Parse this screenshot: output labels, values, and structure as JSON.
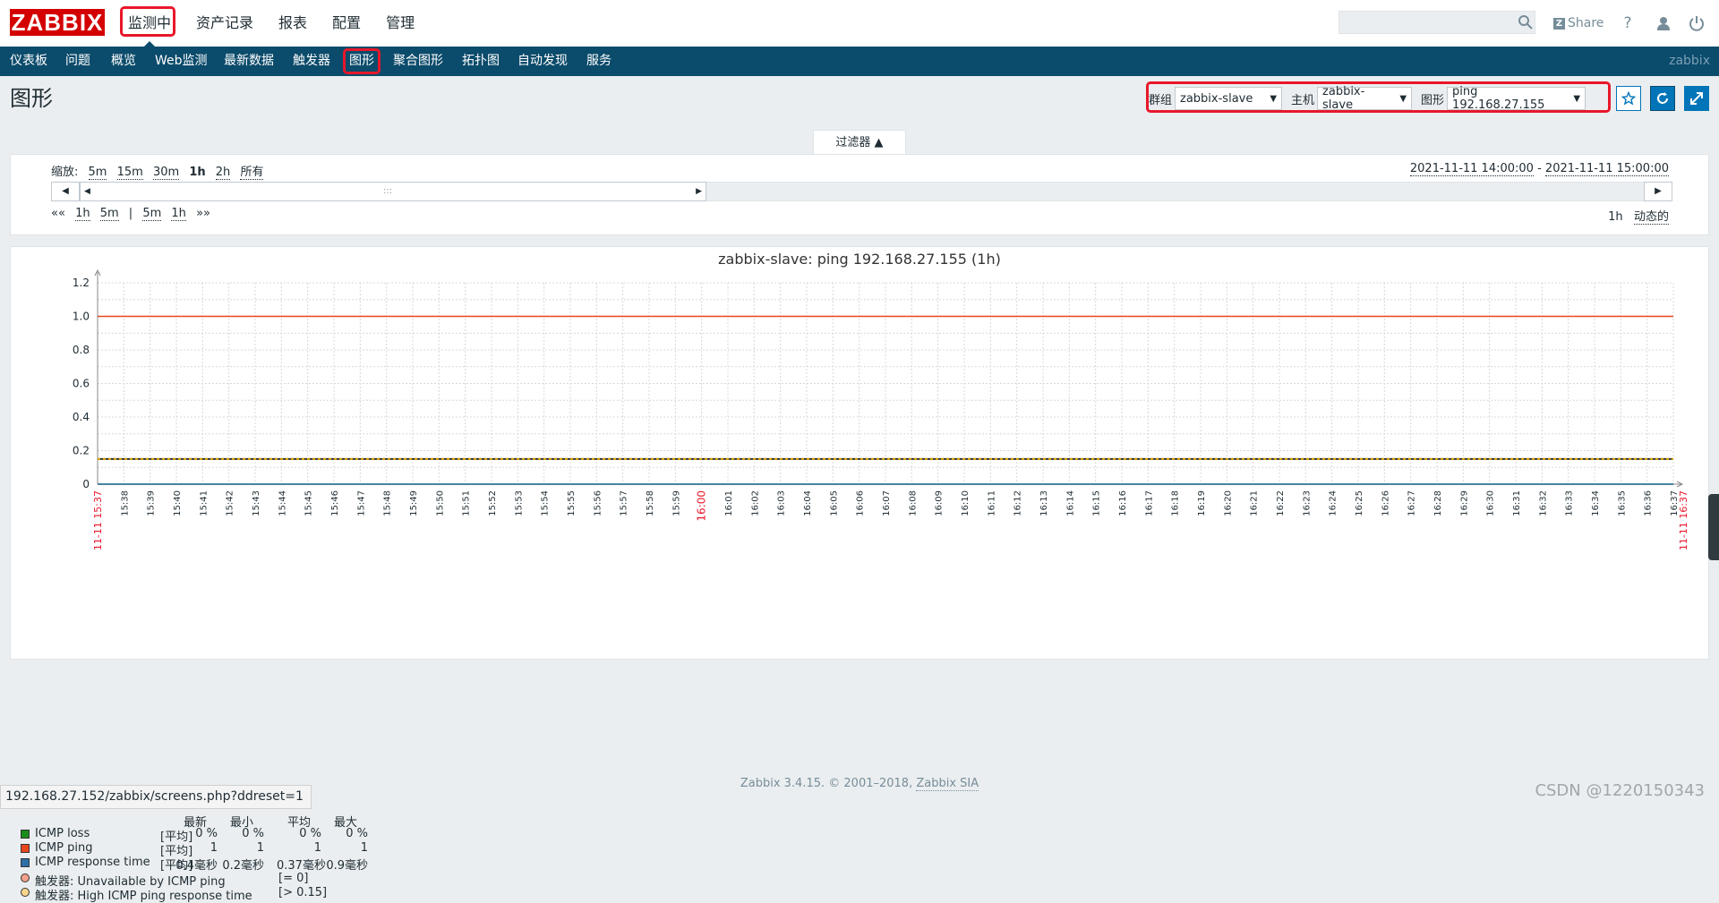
{
  "header": {
    "logo": "ZABBIX",
    "menu": [
      "监测中",
      "资产记录",
      "报表",
      "配置",
      "管理"
    ],
    "share_label": "Share",
    "help_label": "?",
    "icons": [
      "search-icon",
      "help-icon",
      "user-icon",
      "power-icon"
    ]
  },
  "subnav": {
    "items": [
      "仪表板",
      "问题",
      "概览",
      "Web监测",
      "最新数据",
      "触发器",
      "图形",
      "聚合图形",
      "拓扑图",
      "自动发现",
      "服务"
    ],
    "brand": "zabbix"
  },
  "page": {
    "title": "图形",
    "group_label": "群组",
    "group_value": "zabbix-slave",
    "host_label": "主机",
    "host_value": "zabbix-slave",
    "graph_label": "图形",
    "graph_value": "ping 192.168.27.155"
  },
  "filter": {
    "tab_label": "过滤器 ▲",
    "zoom_label": "缩放:",
    "zoom_options": [
      "5m",
      "15m",
      "30m",
      "1h",
      "2h",
      "所有"
    ],
    "date_from": "2021-11-11 14:00:00",
    "date_sep": " - ",
    "date_to": "2021-11-11 15:00:00",
    "nav_left": [
      "««",
      "1h",
      "5m",
      "|",
      "5m",
      "1h",
      "»»"
    ],
    "period": "1h",
    "dynamic_label": "动态的"
  },
  "chart_data": {
    "type": "line",
    "title": "zabbix-slave: ping 192.168.27.155 (1h)",
    "y_ticks": [
      "1.2",
      "1.0",
      "0.8",
      "0.6",
      "0.4",
      "0.2",
      "0"
    ],
    "ylim": [
      0,
      1.2
    ],
    "x_start_label": "11-11 15:37",
    "x_end_label": "11-11 16:37",
    "x_ticks": [
      "15:38",
      "15:39",
      "15:40",
      "15:41",
      "15:42",
      "15:43",
      "15:44",
      "15:45",
      "15:46",
      "15:47",
      "15:48",
      "15:49",
      "15:50",
      "15:51",
      "15:52",
      "15:53",
      "15:54",
      "15:55",
      "15:56",
      "15:57",
      "15:58",
      "15:59",
      "16:00",
      "16:01",
      "16:02",
      "16:03",
      "16:04",
      "16:05",
      "16:06",
      "16:07",
      "16:08",
      "16:09",
      "16:10",
      "16:11",
      "16:12",
      "16:13",
      "16:14",
      "16:15",
      "16:16",
      "16:17",
      "16:18",
      "16:19",
      "16:20",
      "16:21",
      "16:22",
      "16:23",
      "16:24",
      "16:25",
      "16:26",
      "16:27",
      "16:28",
      "16:29",
      "16:30",
      "16:31",
      "16:32",
      "16:33",
      "16:34",
      "16:35",
      "16:36",
      "16:37"
    ],
    "highlight_tick": "16:00",
    "series": [
      {
        "name": "ICMP loss",
        "color": "#1a8c1a",
        "value": 0
      },
      {
        "name": "ICMP ping",
        "color": "#e8471e",
        "value": 1
      },
      {
        "name": "ICMP response time",
        "color": "#2e6fa8",
        "value": 0
      }
    ],
    "trigger_line": {
      "value": 0.15,
      "color": "#d9a400"
    },
    "grid": true
  },
  "legend": {
    "col_headers": [
      "最新",
      "最小",
      "平均",
      "最大"
    ],
    "rows": [
      {
        "name": "ICMP loss",
        "func": "[平均]",
        "vals": [
          "0 %",
          "0 %",
          "0 %",
          "0 %"
        ],
        "color": "#1a8c1a"
      },
      {
        "name": "ICMP ping",
        "func": "[平均]",
        "vals": [
          "1",
          "1",
          "1",
          "1"
        ],
        "color": "#e8471e"
      },
      {
        "name": "ICMP response time",
        "func": "[平均]",
        "vals": [
          "0.4毫秒",
          "0.2毫秒",
          "0.37毫秒",
          "0.9毫秒"
        ],
        "color": "#2e6fa8"
      }
    ],
    "triggers": [
      {
        "text": "触发器: Unavailable by ICMP ping",
        "cond": "[= 0]",
        "color": "#f4a08a"
      },
      {
        "text": "触发器: High ICMP ping response time",
        "cond": "[> 0.15]",
        "color": "#f7d58a"
      }
    ]
  },
  "footer": {
    "text": "Zabbix 3.4.15. © 2001–2018, ",
    "link": "Zabbix SIA"
  },
  "status_url": "192.168.27.152/zabbix/screens.php?ddreset=1",
  "watermark": "CSDN @1220150343"
}
